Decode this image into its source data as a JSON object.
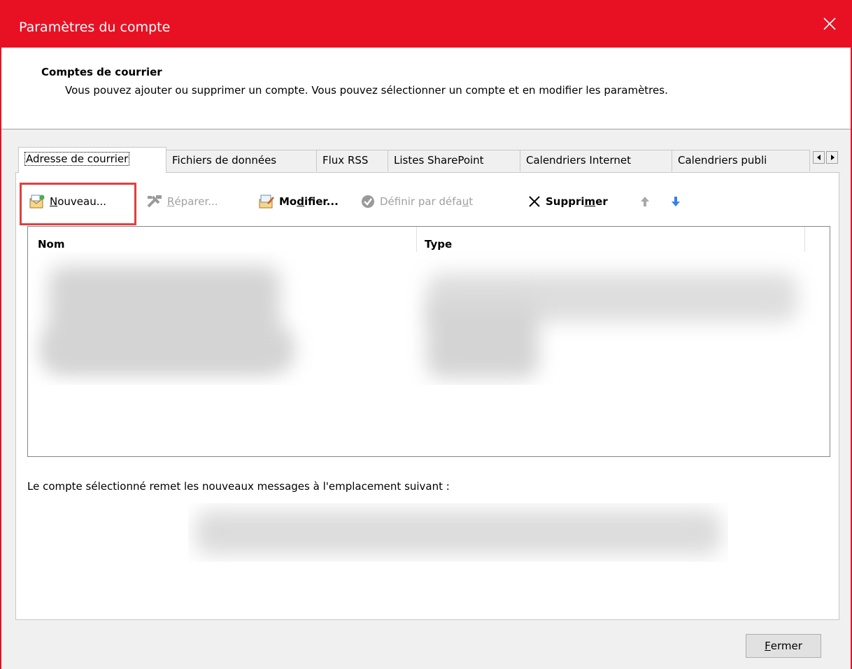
{
  "window": {
    "title": "Paramètres du compte",
    "close_icon": "close-icon"
  },
  "header": {
    "title": "Comptes de courrier",
    "description": "Vous pouvez ajouter ou supprimer un compte. Vous pouvez sélectionner un compte et en modifier les paramètres."
  },
  "tabs": [
    {
      "label": "Adresse de courrier",
      "active": true
    },
    {
      "label": "Fichiers de données",
      "active": false
    },
    {
      "label": "Flux RSS",
      "active": false
    },
    {
      "label": "Listes SharePoint",
      "active": false
    },
    {
      "label": "Calendriers Internet",
      "active": false
    },
    {
      "label": "Calendriers publi",
      "active": false
    }
  ],
  "toolbar": {
    "new_pre": "",
    "new_accel": "N",
    "new_post": "ouveau...",
    "repair_pre": "",
    "repair_accel": "R",
    "repair_post": "éparer...",
    "modify_pre": "Mo",
    "modify_accel": "d",
    "modify_post": "ifier...",
    "default_pre": "Définir par défa",
    "default_accel": "u",
    "default_post": "t",
    "delete_pre": "Suppri",
    "delete_accel": "m",
    "delete_post": "er"
  },
  "list": {
    "columns": [
      "Nom",
      "Type"
    ]
  },
  "location_label": "Le compte sélectionné remet les nouveaux messages à l'emplacement suivant :",
  "footer": {
    "close_accel": "F",
    "close_post": "ermer"
  },
  "colors": {
    "titlebar": "#e81123",
    "highlight": "#e0403e",
    "arrow_blue": "#3a7fe6"
  }
}
